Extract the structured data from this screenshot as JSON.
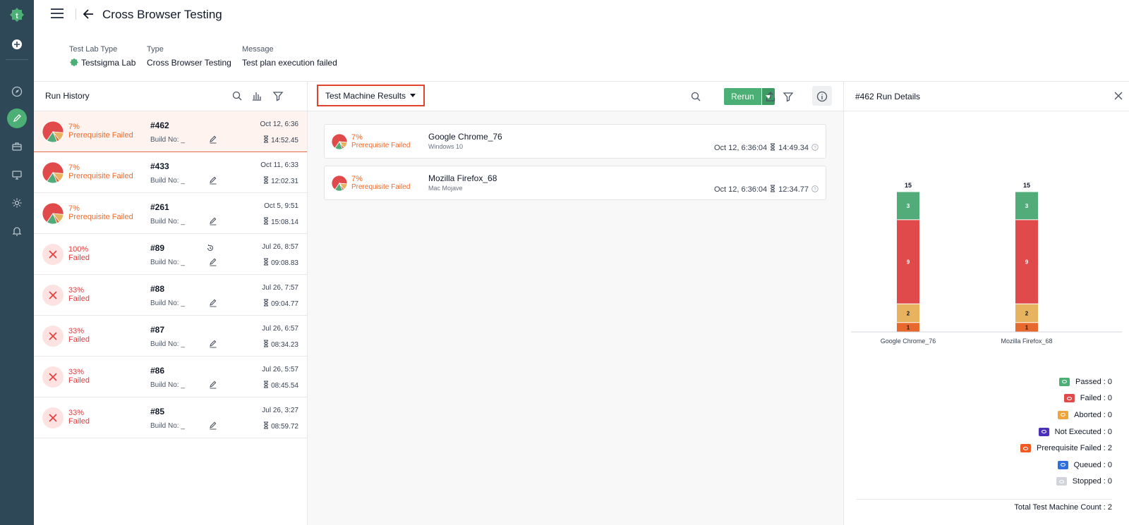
{
  "header": {
    "title": "Cross Browser Testing",
    "meta": [
      {
        "label": "Test Lab Type",
        "value": "Testsigma Lab"
      },
      {
        "label": "Type",
        "value": "Cross Browser Testing"
      },
      {
        "label": "Message",
        "value": "Test plan execution failed"
      }
    ]
  },
  "run_history": {
    "title": "Run History",
    "runs": [
      {
        "pct": "7%",
        "status": "Prerequisite Failed",
        "id": "#462",
        "build": "Build No: _",
        "date": "Oct 12, 6:36",
        "duration": "14:52.45"
      },
      {
        "pct": "7%",
        "status": "Prerequisite Failed",
        "id": "#433",
        "build": "Build No: _",
        "date": "Oct 11, 6:33",
        "duration": "12:02.31"
      },
      {
        "pct": "7%",
        "status": "Prerequisite Failed",
        "id": "#261",
        "build": "Build No: _",
        "date": "Oct 5, 9:51",
        "duration": "15:08.14"
      },
      {
        "pct": "100%",
        "status": "Failed",
        "id": "#89",
        "build": "Build No: _",
        "date": "Jul 26, 8:57",
        "duration": "09:08.83"
      },
      {
        "pct": "33%",
        "status": "Failed",
        "id": "#88",
        "build": "Build No: _",
        "date": "Jul 26, 7:57",
        "duration": "09:04.77"
      },
      {
        "pct": "33%",
        "status": "Failed",
        "id": "#87",
        "build": "Build No: _",
        "date": "Jul 26, 6:57",
        "duration": "08:34.23"
      },
      {
        "pct": "33%",
        "status": "Failed",
        "id": "#86",
        "build": "Build No: _",
        "date": "Jul 26, 5:57",
        "duration": "08:45.54"
      },
      {
        "pct": "33%",
        "status": "Failed",
        "id": "#85",
        "build": "Build No: _",
        "date": "Jul 26, 3:27",
        "duration": "08:59.72"
      }
    ]
  },
  "results": {
    "dropdown_label": "Test Machine Results",
    "rerun_label": "Rerun",
    "machines": [
      {
        "pct": "7%",
        "status": "Prerequisite Failed",
        "name": "Google Chrome_76",
        "os": "Windows 10",
        "date": "Oct 12, 6:36:04",
        "duration": "14:49.34"
      },
      {
        "pct": "7%",
        "status": "Prerequisite Failed",
        "name": "Mozilla Firefox_68",
        "os": "Mac Mojave",
        "date": "Oct 12, 6:36:04",
        "duration": "12:34.77"
      }
    ]
  },
  "details": {
    "title": "#462 Run Details",
    "legend": [
      {
        "label": "Passed : 0",
        "color": "#4caf75"
      },
      {
        "label": "Failed : 0",
        "color": "#e04a4a"
      },
      {
        "label": "Aborted : 0",
        "color": "#f0a43a"
      },
      {
        "label": "Not Executed : 0",
        "color": "#4a2fb8"
      },
      {
        "label": "Prerequisite Failed : 2",
        "color": "#f05a24"
      },
      {
        "label": "Queued : 0",
        "color": "#2f6fe0"
      },
      {
        "label": "Stopped : 0",
        "color": "#d1d5db"
      }
    ],
    "total": "Total Test Machine Count : 2"
  },
  "chart_data": {
    "type": "bar",
    "stacked": true,
    "categories": [
      "Google Chrome_76",
      "Mozilla Firefox_68"
    ],
    "totals": [
      15,
      15
    ],
    "series": [
      {
        "values": [
          1,
          1
        ],
        "color": "#e8692e"
      },
      {
        "values": [
          2,
          2
        ],
        "color": "#e8b35f"
      },
      {
        "values": [
          9,
          9
        ],
        "color": "#e04a4a"
      },
      {
        "values": [
          3,
          3
        ],
        "color": "#52ac7a"
      }
    ],
    "ylim": [
      0,
      15
    ]
  }
}
